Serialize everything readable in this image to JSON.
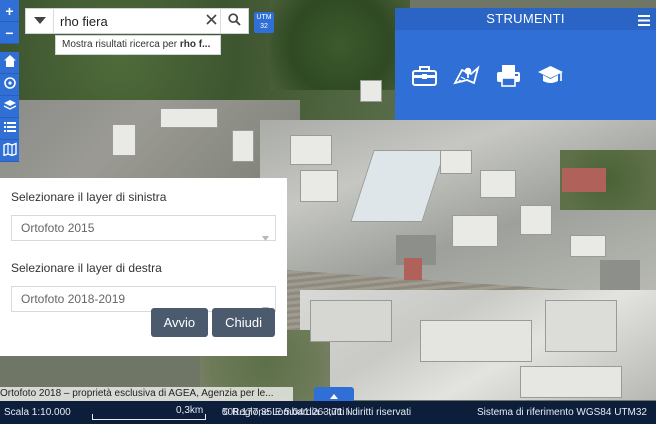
{
  "search": {
    "value": "rho fiera",
    "suggestion_prefix": "Mostra risultati ricerca per ",
    "suggestion_query": "rho f..."
  },
  "utm_badge": {
    "line1": "UTM",
    "line2": "32"
  },
  "zoom": {
    "in_label": "+",
    "out_label": "−"
  },
  "icons": {
    "dropdown": "caret-down-icon",
    "clear": "close-icon",
    "search": "search-icon",
    "home": "home-icon",
    "locate": "target-icon",
    "layers": "layers-icon",
    "list": "list-icon",
    "map_book": "map-icon",
    "menu": "hamburger-icon",
    "toolbox": "toolbox-icon",
    "measure": "map-ruler-icon",
    "print": "printer-icon",
    "graduate": "graduation-cap-icon"
  },
  "strumenti": {
    "title": "STRUMENTI"
  },
  "layer_panel": {
    "left_label": "Selezionare il layer di sinistra",
    "left_value": "Ortofoto 2015",
    "right_label": "Selezionare il layer di destra",
    "right_value": "Ortofoto 2018-2019",
    "start_label": "Avvio",
    "close_label": "Chiudi"
  },
  "attribution": "Ortofoto 2018 – proprietà esclusiva di AGEA, Agenzia per le...",
  "status": {
    "scale": "Scala 1:10.000",
    "scalebar_label": "0,3km",
    "copyright": "© Regione Lombardia - tutti i diritti riservati",
    "coords": "508.177,35 E 5.041.263,71 N",
    "crs": "Sistema di riferimento WGS84 UTM32"
  },
  "colors": {
    "accent": "#2f6fd6",
    "status_bar": "#0d1e3a",
    "button": "#4b5a6d"
  }
}
